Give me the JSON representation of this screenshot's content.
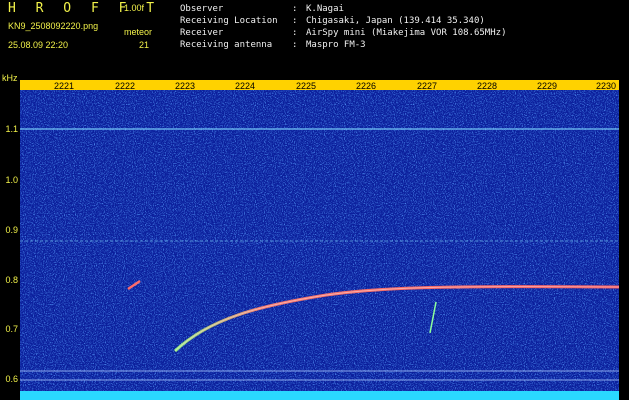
{
  "header": {
    "logo": "H R O F F T",
    "version": "1.00f",
    "filename": "KN9_2508092220.png",
    "timestamp": "25.08.09 22:20",
    "meteor_label": "meteor",
    "meteor_count": "21",
    "info": [
      {
        "key": "Observer",
        "value": "K.Nagai"
      },
      {
        "key": "Receiving Location",
        "value": "Chigasaki, Japan (139.414 35.340)"
      },
      {
        "key": "Receiver",
        "value": "AirSpy mini (Miakejima VOR 108.65MHz)"
      },
      {
        "key": "Receiving antenna",
        "value": "Maspro FM-3"
      }
    ]
  },
  "plot": {
    "y_unit": "kHz",
    "y_ticks": [
      "1.1",
      "1.0",
      "0.9",
      "0.8",
      "0.7",
      "0.6"
    ],
    "x_ticks": [
      "2221",
      "2222",
      "2223",
      "2224",
      "2225",
      "2226",
      "2227",
      "2228",
      "2229",
      "2230"
    ],
    "colors": {
      "background": "#0b1f9c",
      "scale_bar": "#ffd200",
      "trail": "#ff5a5a",
      "line": "#7fd8ff"
    }
  }
}
